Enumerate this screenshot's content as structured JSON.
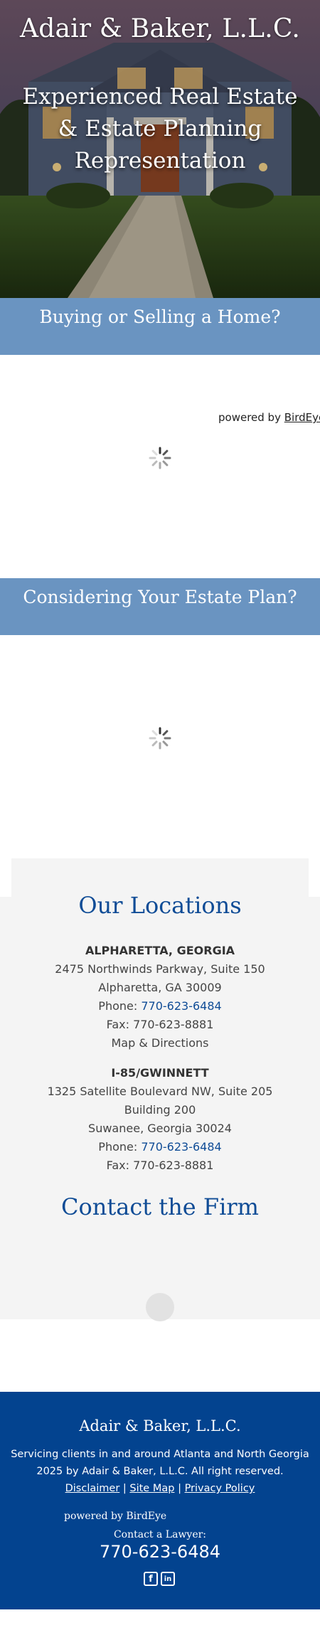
{
  "hero": {
    "firm_name": "Adair & Baker, L.L.C.",
    "tagline": "Experienced Real Estate & Estate Planning Representation"
  },
  "sections": {
    "buying_title": "Buying or Selling a Home?",
    "estate_title": "Considering Your Estate Plan?"
  },
  "reviews": {
    "powered_prefix": "powered by",
    "powered_link": "BirdEye"
  },
  "locations": {
    "title": "Our Locations",
    "offices": [
      {
        "name": "ALPHARETTA, GEORGIA",
        "address1": "2475 Northwinds Parkway, Suite 150",
        "address2": "Alpharetta, GA 30009",
        "phone_label": "Phone:",
        "phone": "770-623-6484",
        "fax": "Fax: 770-623-8881",
        "map_link": "Map & Directions"
      },
      {
        "name": "I-85/GWINNETT",
        "address1": "1325 Satellite Boulevard NW, Suite 205",
        "address2": "Building 200",
        "address3": "Suwanee, Georgia 30024",
        "phone_label": "Phone:",
        "phone": "770-623-6484",
        "fax": "Fax: 770-623-8881"
      }
    ]
  },
  "contact": {
    "title": "Contact the Firm"
  },
  "footer": {
    "firm_name": "Adair & Baker, L.L.C.",
    "service_line": "Servicing clients in and around Atlanta and North Georgia",
    "copyright": "2025 by Adair & Baker, L.L.C. All right reserved.",
    "links": [
      "Disclaimer",
      "Site Map",
      "Privacy Policy"
    ],
    "separator": "|",
    "powered_by": "powered by BirdEye",
    "contact_label": "Contact a Lawyer:",
    "phone": "770-623-6484",
    "social": [
      {
        "icon": "facebook-icon",
        "glyph": "f"
      },
      {
        "icon": "linkedin-icon",
        "glyph": "in"
      }
    ]
  },
  "colors": {
    "brand_blue": "#03438f",
    "band_blue": "#6a94c1",
    "heading_blue": "#0f4c96",
    "panel_gray": "#f4f4f4"
  }
}
